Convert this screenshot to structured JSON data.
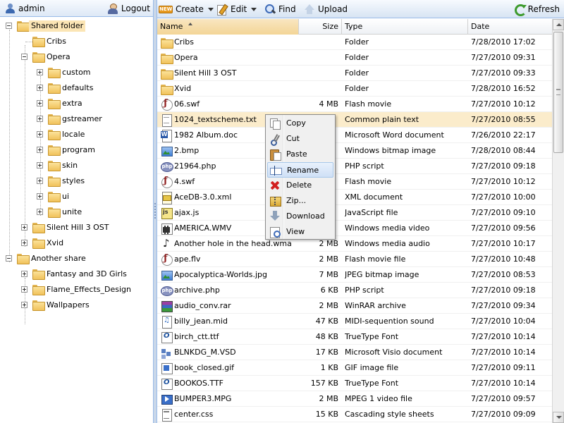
{
  "user": {
    "name": "admin",
    "logout_label": "Logout"
  },
  "toolbar": {
    "new_badge": "NEW",
    "create_label": "Create",
    "edit_label": "Edit",
    "find_label": "Find",
    "upload_label": "Upload",
    "refresh_label": "Refresh"
  },
  "tree": {
    "shared_folder": "Shared folder",
    "cribs": "Cribs",
    "opera": "Opera",
    "opera_children": [
      "custom",
      "defaults",
      "extra",
      "gstreamer",
      "locale",
      "program",
      "skin",
      "styles",
      "ui",
      "unite"
    ],
    "silent_hill": "Silent Hill 3 OST",
    "xvid": "Xvid",
    "another_share": "Another share",
    "another_children": [
      "Fantasy and 3D Girls",
      "Flame_Effects_Design",
      "Wallpapers"
    ]
  },
  "grid": {
    "columns": {
      "name": "Name",
      "size": "Size",
      "type": "Type",
      "date": "Date"
    },
    "rows": [
      {
        "name": "Cribs",
        "size": "",
        "type": "Folder",
        "date": "7/28/2010 17:02",
        "icon": "folder-icon"
      },
      {
        "name": "Opera",
        "size": "",
        "type": "Folder",
        "date": "7/27/2010 09:31",
        "icon": "folder-icon"
      },
      {
        "name": "Silent Hill 3 OST",
        "size": "",
        "type": "Folder",
        "date": "7/27/2010 09:33",
        "icon": "folder-icon"
      },
      {
        "name": "Xvid",
        "size": "",
        "type": "Folder",
        "date": "7/28/2010 16:52",
        "icon": "folder-icon"
      },
      {
        "name": "06.swf",
        "size": "4 MB",
        "type": "Flash movie",
        "date": "7/27/2010 10:12",
        "icon": "flash-icon"
      },
      {
        "name": "1024_textscheme.txt",
        "size": "",
        "type": "Common plain text",
        "date": "7/27/2010 08:55",
        "icon": "text-file-icon"
      },
      {
        "name": "1982 Album.doc",
        "size": "",
        "type": "Microsoft Word document",
        "date": "7/26/2010 22:17",
        "icon": "word-document-icon"
      },
      {
        "name": "2.bmp",
        "size": "",
        "type": "Windows bitmap image",
        "date": "7/28/2010 08:44",
        "icon": "image-icon"
      },
      {
        "name": "21964.php",
        "size": "",
        "type": "PHP script",
        "date": "7/27/2010 09:18",
        "icon": "php-icon"
      },
      {
        "name": "4.swf",
        "size": "",
        "type": "Flash movie",
        "date": "7/27/2010 10:12",
        "icon": "flash-icon"
      },
      {
        "name": "AceDB-3.0.xml",
        "size": "",
        "type": "XML document",
        "date": "7/27/2010 10:00",
        "icon": "xml-icon"
      },
      {
        "name": "ajax.js",
        "size": "",
        "type": "JavaScript file",
        "date": "7/27/2010 09:10",
        "icon": "javascript-icon"
      },
      {
        "name": "AMERICA.WMV",
        "size": "",
        "type": "Windows media video",
        "date": "7/27/2010 09:56",
        "icon": "video-icon"
      },
      {
        "name": "Another hole in the head.wma",
        "size": "2 MB",
        "type": "Windows media audio",
        "date": "7/27/2010 10:17",
        "icon": "audio-icon"
      },
      {
        "name": "ape.flv",
        "size": "2 MB",
        "type": "Flash movie file",
        "date": "7/27/2010 10:48",
        "icon": "flash-video-icon"
      },
      {
        "name": "Apocalyptica-Worlds.jpg",
        "size": "7 MB",
        "type": "JPEG bitmap image",
        "date": "7/27/2010 08:53",
        "icon": "image-icon"
      },
      {
        "name": "archive.php",
        "size": "6 KB",
        "type": "PHP script",
        "date": "7/27/2010 09:18",
        "icon": "php-icon"
      },
      {
        "name": "audio_conv.rar",
        "size": "2 MB",
        "type": "WinRAR archive",
        "date": "7/27/2010 09:34",
        "icon": "rar-archive-icon"
      },
      {
        "name": "billy_jean.mid",
        "size": "47 KB",
        "type": "MIDI-sequention sound",
        "date": "7/27/2010 10:04",
        "icon": "midi-icon"
      },
      {
        "name": "birch_ctt.ttf",
        "size": "48 KB",
        "type": "TrueType Font",
        "date": "7/27/2010 10:14",
        "icon": "font-icon"
      },
      {
        "name": "BLNKDG_M.VSD",
        "size": "17 KB",
        "type": "Microsoft Visio document",
        "date": "7/27/2010 10:14",
        "icon": "visio-icon"
      },
      {
        "name": "book_closed.gif",
        "size": "1 KB",
        "type": "GIF image file",
        "date": "7/27/2010 09:11",
        "icon": "gif-icon"
      },
      {
        "name": "BOOKOS.TTF",
        "size": "157 KB",
        "type": "TrueType Font",
        "date": "7/27/2010 10:14",
        "icon": "font-icon"
      },
      {
        "name": "BUMPER3.MPG",
        "size": "2 MB",
        "type": "MPEG 1 video file",
        "date": "7/27/2010 09:57",
        "icon": "mpeg-icon"
      },
      {
        "name": "center.css",
        "size": "15 KB",
        "type": "Cascading style sheets",
        "date": "7/27/2010 09:09",
        "icon": "css-icon"
      }
    ]
  },
  "context_menu": {
    "items": [
      {
        "label": "Copy",
        "icon": "copy-icon"
      },
      {
        "label": "Cut",
        "icon": "cut-icon"
      },
      {
        "label": "Paste",
        "icon": "paste-icon"
      },
      {
        "label": "Rename",
        "icon": "rename-icon"
      },
      {
        "label": "Delete",
        "icon": "delete-icon"
      },
      {
        "label": "Zip...",
        "icon": "zip-icon"
      },
      {
        "label": "Download",
        "icon": "download-icon"
      },
      {
        "label": "View",
        "icon": "view-icon"
      }
    ]
  }
}
